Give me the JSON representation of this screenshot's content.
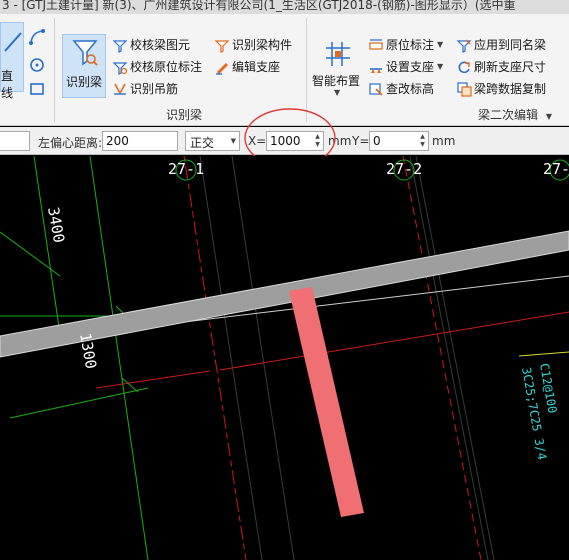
{
  "title": "3 - [GTJ土建计量] 新(3)、广州建筑设计有限公司(1_生活区(GTJ2018-(钢筋)-图形显示）(选中重",
  "ribbon": {
    "left_partial_label": "直线",
    "recognize_beam_label": "识别梁",
    "check_beam_element": "校核梁图元",
    "check_original_annotation": "校核原位标注",
    "recognize_hanger_bar": "识别吊筋",
    "recognize_beam_member": "识别梁构件",
    "edit_support": "编辑支座",
    "group_recognize_beam": "识别梁",
    "smart_layout": "智能布置",
    "original_annotation": "原位标注",
    "set_support": "设置支座",
    "check_elevation": "查改标高",
    "apply_same_name_beam": "应用到同名梁",
    "refresh_support_size": "刷新支座尺寸",
    "beam_span_copy": "梁跨数据复制",
    "group_beam_secondary_edit": "梁二次编辑"
  },
  "toolbar": {
    "left_offset_label": "左偏心距离:",
    "left_offset_value": "200",
    "mode_value": "正交",
    "x_label": "X=",
    "x_value": "1000",
    "x_unit": "mm",
    "y_label": "Y=",
    "y_value": "0",
    "y_unit": "mm"
  },
  "canvas": {
    "axis_labels": [
      "27-1",
      "27-2",
      "27-"
    ],
    "dim_3400": "3400",
    "dim_1300": "1300",
    "annotation_line1": "C12@100",
    "annotation_line2": "3C25;7C25 3/4"
  },
  "colors": {
    "beam": "#9e9e9e",
    "selected_element": "#ef6f73",
    "grid_red": "#d01818",
    "grid_green": "#18b018",
    "highlight_circle": "#e03a3a",
    "annotation_cyan": "#38d8d8"
  }
}
